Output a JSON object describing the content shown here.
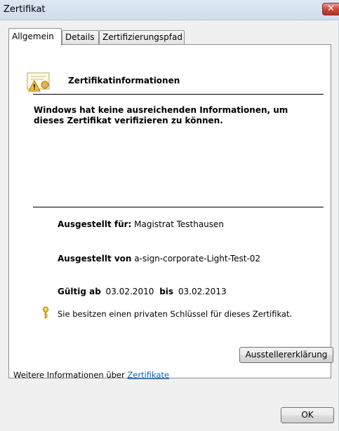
{
  "window": {
    "title": "Zertifikat",
    "close_glyph": "✕"
  },
  "tabs": [
    {
      "label": "Allgemein",
      "active": true
    },
    {
      "label": "Details",
      "active": false
    },
    {
      "label": "Zertifizierungspfad",
      "active": false
    }
  ],
  "certificate": {
    "icon": "certificate-warning-icon",
    "heading": "Zertifikatinformationen",
    "warning": "Windows hat keine ausreichenden Informationen, um dieses Zertifikat verifizieren zu können.",
    "issued_to_label": "Ausgestellt für:",
    "issued_to_value": "Magistrat Testhausen",
    "issued_by_label": "Ausgestellt von",
    "issued_by_value": "a-sign-corporate-Light-Test-02",
    "valid_from_label": "Gültig ab",
    "valid_from_value": "03.02.2010",
    "valid_to_label": "bis",
    "valid_to_value": "03.02.2013",
    "key_icon": "key-icon",
    "private_key_text": "Sie besitzen einen privaten Schlüssel für dieses Zertifikat."
  },
  "buttons": {
    "issuer_statement": "Ausstellererklärung",
    "ok": "OK"
  },
  "footer": {
    "more_info_text": "Weitere Informationen über",
    "more_info_link": "Zertifikate"
  },
  "colors": {
    "link": "#0066cc",
    "close_button": "#c8483a"
  }
}
